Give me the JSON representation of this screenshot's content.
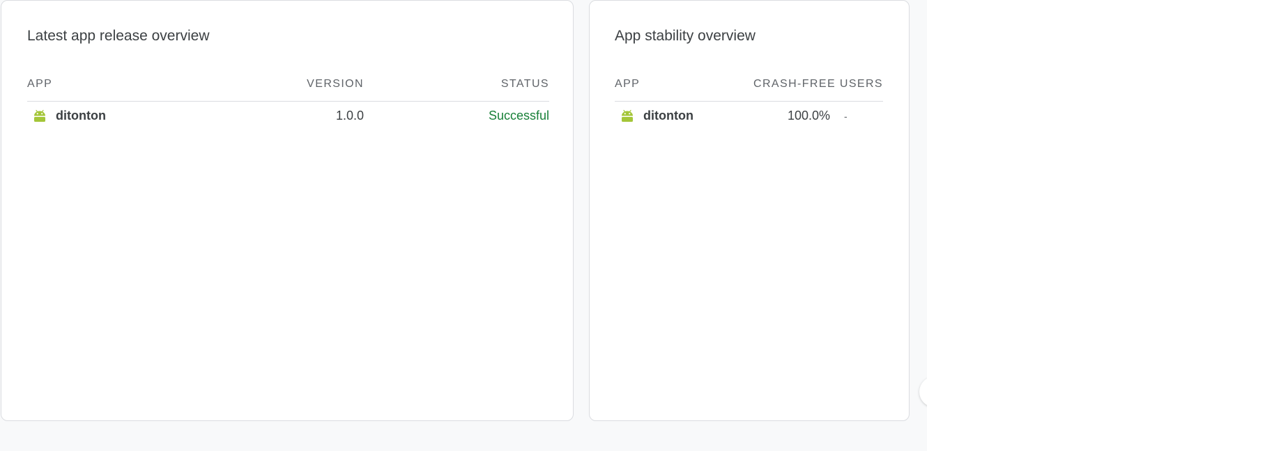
{
  "release_card": {
    "title": "Latest app release overview",
    "columns": {
      "app": "APP",
      "version": "VERSION",
      "status": "STATUS"
    },
    "rows": [
      {
        "app": "ditonton",
        "platform_icon": "android-icon",
        "version": "1.0.0",
        "status": "Successful"
      }
    ]
  },
  "stability_card": {
    "title": "App stability overview",
    "columns": {
      "app": "APP",
      "crash_free_users": "CRASH-FREE USERS"
    },
    "rows": [
      {
        "app": "ditonton",
        "platform_icon": "android-icon",
        "crash_free_users": "100.0%",
        "trend": "-"
      }
    ]
  },
  "colors": {
    "success": "#188038",
    "android": "#a4c639",
    "border": "#dadce0",
    "page_background": "#f8f9fa"
  }
}
